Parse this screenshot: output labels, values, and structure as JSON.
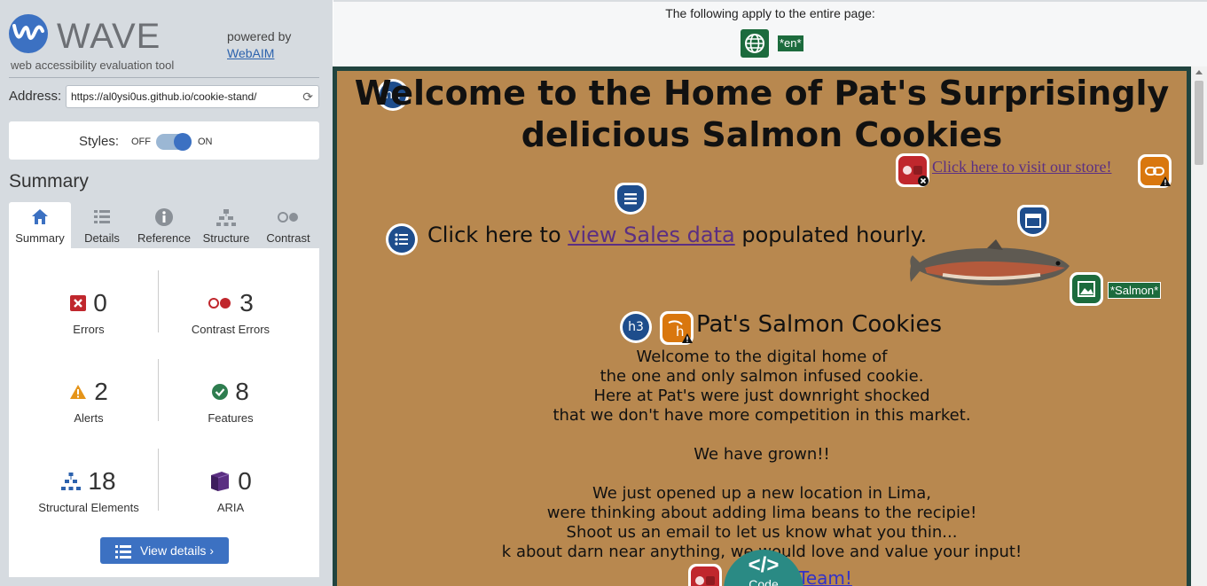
{
  "brand": {
    "name": "WAVE",
    "tagline": "web accessibility evaluation tool",
    "powered_by": "powered by",
    "webaim": "WebAIM"
  },
  "address": {
    "label": "Address:",
    "value": "https://al0ysi0us.github.io/cookie-stand/"
  },
  "styles": {
    "label": "Styles:",
    "off": "OFF",
    "on": "ON",
    "state": "on"
  },
  "summary_heading": "Summary",
  "tabs": [
    {
      "label": "Summary",
      "icon": "home-icon",
      "active": true
    },
    {
      "label": "Details",
      "icon": "list-icon",
      "active": false
    },
    {
      "label": "Reference",
      "icon": "info-icon",
      "active": false
    },
    {
      "label": "Structure",
      "icon": "hierarchy-icon",
      "active": false
    },
    {
      "label": "Contrast",
      "icon": "contrast-icon",
      "active": false
    }
  ],
  "stats": {
    "errors": {
      "count": "0",
      "label": "Errors",
      "color": "#c0272d"
    },
    "contrast_errors": {
      "count": "3",
      "label": "Contrast Errors",
      "color": "#c0272d"
    },
    "alerts": {
      "count": "2",
      "label": "Alerts",
      "color": "#e59419"
    },
    "features": {
      "count": "8",
      "label": "Features",
      "color": "#2e7d4f"
    },
    "structural": {
      "count": "18",
      "label": "Structural Elements",
      "color": "#2c62ad"
    },
    "aria": {
      "count": "0",
      "label": "ARIA",
      "color": "#5b2f82"
    }
  },
  "view_details": "View details ›",
  "topbar": {
    "text": "The following apply to the entire page:",
    "lang_tag": "*en*"
  },
  "page": {
    "h1_badge": "h1",
    "h1": "Welcome to the Home of Pat's Surprisingly delicious Salmon Cookies",
    "store_link": "Click here to visit our store!",
    "sales_prefix": "Click here to ",
    "sales_link": "view Sales data",
    "sales_suffix": " populated hourly.",
    "alt_tag": "*Salmon*",
    "h3_badge": "h3",
    "h3": "Pat's Salmon Cookies",
    "body_lines": [
      "Welcome to the digital home of",
      "the one and only salmon infused cookie.",
      "Here at Pat's were just downright shocked",
      "that we don't have more competition in this market.",
      "",
      "We have grown!!",
      "",
      "We just opened up a new location in Lima,",
      "were thinking about adding lima beans to the recipie!",
      "Shoot us an email to let us know what you thin...",
      "k about darn near anything, we would love and value your input!"
    ],
    "team_link": "Team!",
    "colors": {
      "background": "#b8884f",
      "link_visited": "#5b2f82"
    }
  },
  "code_button": {
    "glyph": "</>",
    "label": "Code"
  },
  "colors": {
    "accent": "#3c71c2",
    "sidebar_bg": "#d6dbe0",
    "feature_green": "#1c6b3d",
    "structure_navy": "#1e4d8c",
    "alert_orange": "#d9770e",
    "error_red": "#c0272d",
    "frame": "#21443f"
  }
}
